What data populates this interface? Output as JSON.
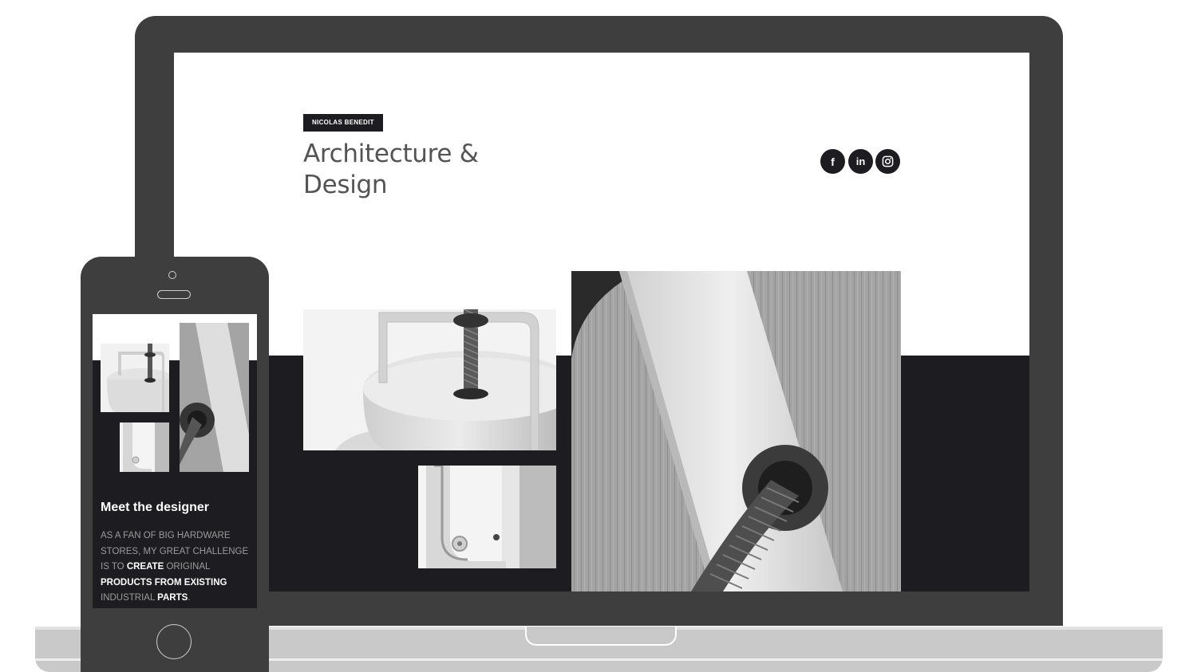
{
  "site": {
    "name_badge": "NICOLAS BENEDIT",
    "title": "Architecture & Design",
    "social": {
      "facebook": "f",
      "linkedin": "in",
      "instagram_icon": "instagram-icon"
    },
    "images": [
      "lamp-top-photo",
      "lamp-detail-photo",
      "lamp-closeup-photo"
    ]
  },
  "mobile": {
    "heading": "Meet the designer",
    "bio": [
      {
        "text": "AS A FAN OF BIG HARDWARE STORES, MY GREAT CHALLENGE IS TO ",
        "highlight": false
      },
      {
        "text": "CREATE",
        "highlight": true
      },
      {
        "text": " ORIGINAL ",
        "highlight": false
      },
      {
        "text": "PRODUCTS FROM EXISTING",
        "highlight": true
      },
      {
        "text": " INDUSTRIAL ",
        "highlight": false
      },
      {
        "text": "PARTS",
        "highlight": true
      },
      {
        "text": ".",
        "highlight": false
      }
    ]
  },
  "colors": {
    "device": "#3e3e3e",
    "site_dark": "#1d1c21",
    "title_gray": "#545454",
    "base_gray": "#c9c9c9"
  }
}
